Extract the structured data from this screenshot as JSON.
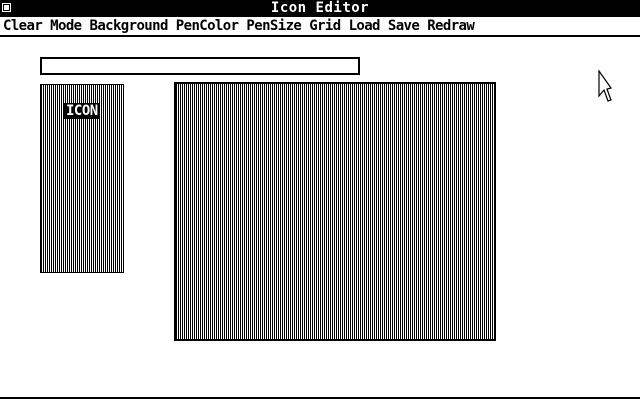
{
  "window": {
    "title": "Icon Editor"
  },
  "menu": {
    "items": [
      {
        "label": "Clear"
      },
      {
        "label": "Mode"
      },
      {
        "label": "Background"
      },
      {
        "label": "PenColor"
      },
      {
        "label": "PenSize"
      },
      {
        "label": "Grid"
      },
      {
        "label": "Load"
      },
      {
        "label": "Save"
      },
      {
        "label": "Redraw"
      }
    ]
  },
  "name_field": {
    "value": "",
    "placeholder": ""
  },
  "preview": {
    "label": "ICON"
  },
  "icons": {
    "close": "close-box-icon",
    "cursor": "arrow-pointer-icon"
  },
  "colors": {
    "foreground": "#000000",
    "background": "#ffffff"
  }
}
